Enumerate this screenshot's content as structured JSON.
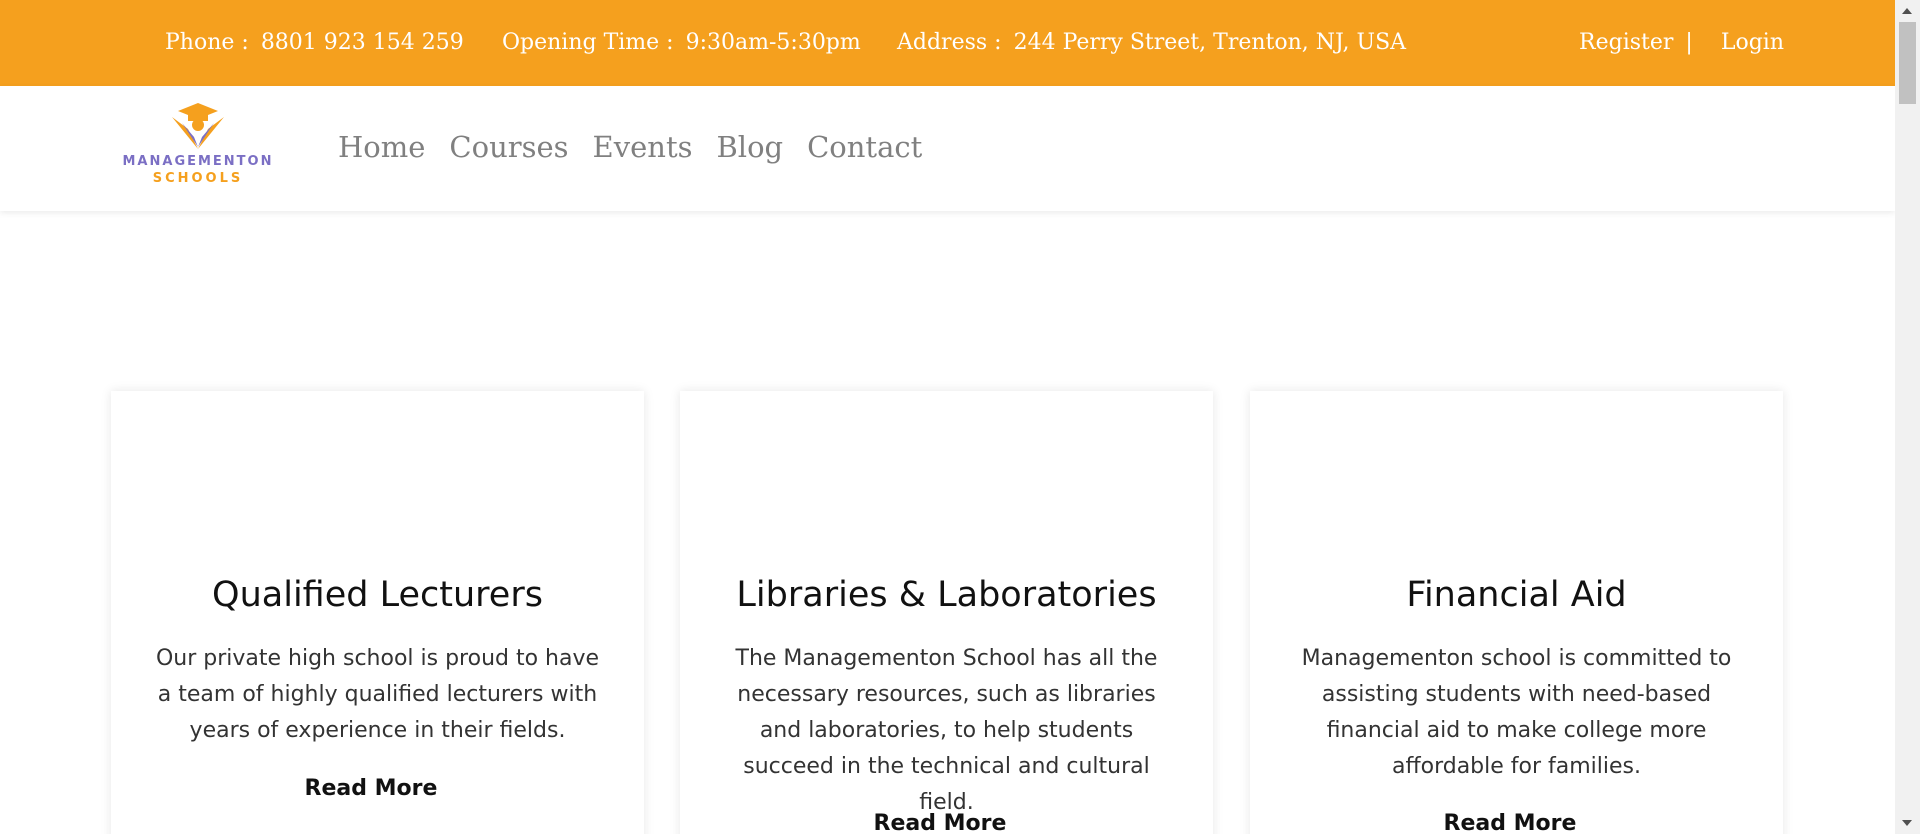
{
  "colors": {
    "accent": "#f5a01e",
    "logo_purple": "#7b6fc4",
    "nav_text": "#808080"
  },
  "topbar": {
    "phone_label": "Phone :",
    "phone_value": "8801 923 154 259",
    "hours_label": "Opening Time :",
    "hours_value": "9:30am-5:30pm",
    "address_label": "Address :",
    "address_value": "244 Perry Street, Trenton, NJ, USA",
    "register_label": "Register",
    "separator": "|",
    "login_label": "Login"
  },
  "logo": {
    "icon": "graduate-cap-icon",
    "line1": "MANAGEMENTON",
    "line2": "SCHOOLS"
  },
  "nav": {
    "items": [
      {
        "label": "Home"
      },
      {
        "label": "Courses"
      },
      {
        "label": "Events"
      },
      {
        "label": "Blog"
      },
      {
        "label": "Contact"
      }
    ]
  },
  "cards": [
    {
      "title": "Qualified Lecturers",
      "text": "Our private high school is proud to have a team of highly qualified lecturers with years of experience in their fields.",
      "link": "Read More"
    },
    {
      "title": "Libraries & Laboratories",
      "text": "The Managementon School has all the necessary resources, such as libraries and laboratories, to help students succeed in the technical and cultural field.",
      "link": "Read More"
    },
    {
      "title": "Financial Aid",
      "text": "Managementon school is committed to assisting students with need-based financial aid to make college more affordable for families.",
      "link": "Read More"
    }
  ]
}
